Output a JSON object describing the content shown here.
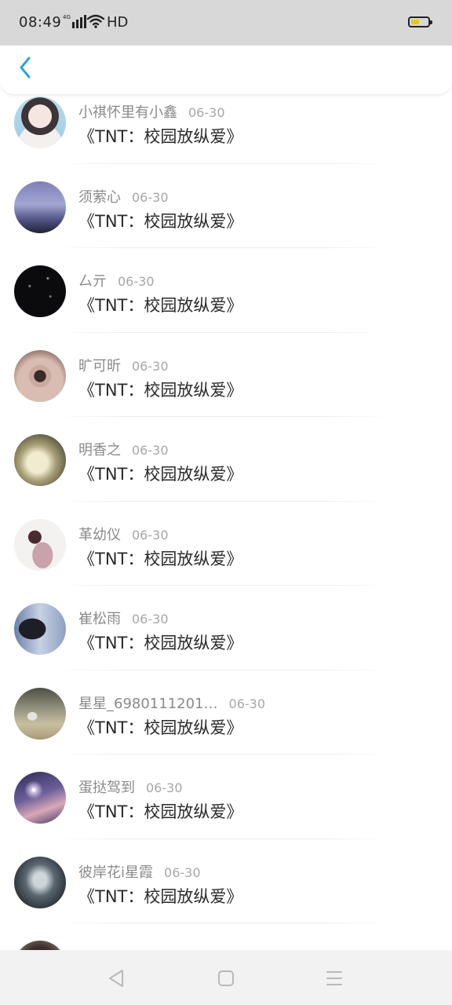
{
  "status_bar": {
    "time": "08:49",
    "network": "4G",
    "hd": "HD",
    "battery_level": 0.5,
    "battery_color": "#f4c20d"
  },
  "header": {
    "back_icon": "chevron-left-icon",
    "accent_color": "#2aa5d8"
  },
  "items": [
    {
      "name": "小祺怀里有小鑫",
      "date": "06-30",
      "title": "《TNT：校园放纵爱》"
    },
    {
      "name": "须萦心",
      "date": "06-30",
      "title": "《TNT：校园放纵爱》"
    },
    {
      "name": "厶亓",
      "date": "06-30",
      "title": "《TNT：校园放纵爱》"
    },
    {
      "name": "旷可昕",
      "date": "06-30",
      "title": "《TNT：校园放纵爱》"
    },
    {
      "name": "明香之",
      "date": "06-30",
      "title": "《TNT：校园放纵爱》"
    },
    {
      "name": "革幼仪",
      "date": "06-30",
      "title": "《TNT：校园放纵爱》"
    },
    {
      "name": "崔松雨",
      "date": "06-30",
      "title": "《TNT：校园放纵爱》"
    },
    {
      "name": "星星_6980111201…",
      "date": "06-30",
      "title": "《TNT：校园放纵爱》"
    },
    {
      "name": "蛋挞驾到",
      "date": "06-30",
      "title": "《TNT：校园放纵爱》"
    },
    {
      "name": "彼岸花i星霞",
      "date": "06-30",
      "title": "《TNT：校园放纵爱》"
    },
    {
      "name": "",
      "date": "",
      "title": ""
    }
  ],
  "nav_bar": {
    "back_icon": "triangle-back-icon",
    "home_icon": "square-home-icon",
    "menu_icon": "menu-lines-icon"
  }
}
